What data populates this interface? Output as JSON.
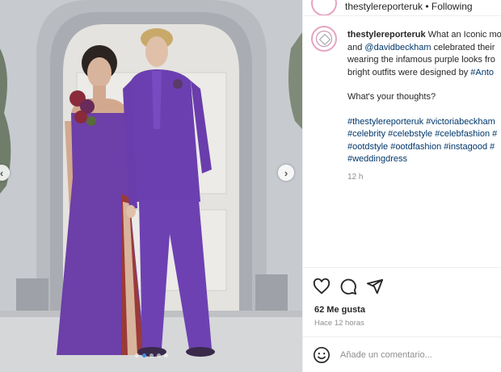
{
  "top_strip": {
    "text": "thestylereporteruk • Following"
  },
  "post": {
    "username": "thestylereporteruk",
    "caption_lines": [
      {
        "prefix": "",
        "text": " What an Iconic mo"
      },
      {
        "prefix": "and ",
        "mention": "@davidbeckham",
        "text": " celebrated their"
      },
      {
        "prefix": "",
        "text": "wearing the infamous purple looks fro"
      },
      {
        "prefix": "bright outfits were designed by ",
        "mention": "#Anto",
        "text": ""
      }
    ],
    "question": "What's your thoughts?",
    "hashtag_lines": [
      "#thestylereporteruk #victoriabeckham",
      "#celebrity #celebstyle #celebfashion #",
      "#ootdstyle #ootdfashion #instagood #",
      "#weddingdress"
    ],
    "time_ago_short": "12 h"
  },
  "actions": {
    "icons": [
      "heart-icon",
      "comment-icon",
      "share-icon"
    ],
    "likes": "62 Me gusta",
    "posted": "Hace 12 horas"
  },
  "comment": {
    "placeholder": "Añade un comentario..."
  },
  "carousel": {
    "total_slides": 5,
    "active_index": 1
  }
}
